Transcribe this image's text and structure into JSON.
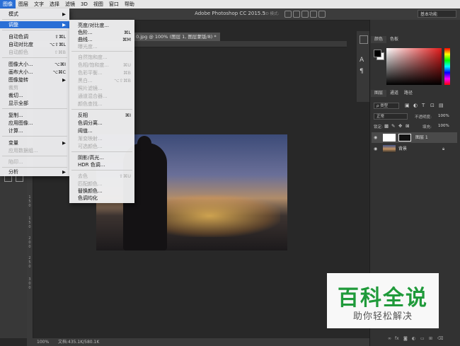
{
  "menubar": {
    "items": [
      "图像",
      "图层",
      "文字",
      "选择",
      "滤镜",
      "3D",
      "视图",
      "窗口",
      "帮助"
    ],
    "active_index": 0
  },
  "app_title": "Adobe Photoshop CC 2015.5",
  "options_bar": {
    "mode_3d": "3D 模式:",
    "workspace": "基本功能"
  },
  "document_tab": {
    "label": "0.jpg @ 100% (图层 1, 图层蒙版/8) *"
  },
  "ruler": {
    "left_labels": [
      "1",
      "5",
      "0",
      "1",
      "5",
      "0",
      "2",
      "0",
      "0",
      "2",
      "5",
      "0",
      "3",
      "0",
      "0"
    ]
  },
  "image_menu": {
    "items": [
      {
        "label": "模式",
        "shortcut": "",
        "arrow": true,
        "disabled": false
      },
      {
        "label": "调整",
        "shortcut": "",
        "arrow": true,
        "disabled": false,
        "highlighted": true
      },
      {
        "label": "自动色调",
        "shortcut": "⇧⌘L",
        "disabled": false
      },
      {
        "label": "自动对比度",
        "shortcut": "⌥⇧⌘L",
        "disabled": false
      },
      {
        "label": "自动颜色",
        "shortcut": "⇧⌘B",
        "disabled": true
      },
      {
        "label": "图像大小...",
        "shortcut": "⌥⌘I",
        "disabled": false
      },
      {
        "label": "画布大小...",
        "shortcut": "⌥⌘C",
        "disabled": false
      },
      {
        "label": "图像旋转",
        "shortcut": "",
        "arrow": true,
        "disabled": false
      },
      {
        "label": "裁剪",
        "shortcut": "",
        "disabled": true
      },
      {
        "label": "裁切...",
        "shortcut": "",
        "disabled": false
      },
      {
        "label": "显示全部",
        "shortcut": "",
        "disabled": false
      },
      {
        "label": "复制...",
        "shortcut": "",
        "disabled": false
      },
      {
        "label": "应用图像...",
        "shortcut": "",
        "disabled": false
      },
      {
        "label": "计算...",
        "shortcut": "",
        "disabled": false
      },
      {
        "label": "变量",
        "shortcut": "",
        "arrow": true,
        "disabled": false
      },
      {
        "label": "应用数据组...",
        "shortcut": "",
        "disabled": true
      },
      {
        "label": "陷印...",
        "shortcut": "",
        "disabled": true
      },
      {
        "label": "分析",
        "shortcut": "",
        "arrow": true,
        "disabled": false
      }
    ]
  },
  "adjust_submenu": {
    "items": [
      {
        "label": "亮度/对比度...",
        "shortcut": "",
        "disabled": false
      },
      {
        "label": "色阶...",
        "shortcut": "⌘L",
        "disabled": false
      },
      {
        "label": "曲线...",
        "shortcut": "⌘M",
        "disabled": false
      },
      {
        "label": "曝光度...",
        "shortcut": "",
        "disabled": true
      },
      {
        "label": "自然饱和度...",
        "shortcut": "",
        "disabled": true
      },
      {
        "label": "色相/饱和度...",
        "shortcut": "⌘U",
        "disabled": true
      },
      {
        "label": "色彩平衡...",
        "shortcut": "⌘B",
        "disabled": true
      },
      {
        "label": "黑白...",
        "shortcut": "⌥⇧⌘B",
        "disabled": true
      },
      {
        "label": "照片滤镜...",
        "shortcut": "",
        "disabled": true
      },
      {
        "label": "通道混合器...",
        "shortcut": "",
        "disabled": true
      },
      {
        "label": "颜色查找...",
        "shortcut": "",
        "disabled": true
      },
      {
        "label": "反相",
        "shortcut": "⌘I",
        "disabled": false
      },
      {
        "label": "色调分离...",
        "shortcut": "",
        "disabled": false
      },
      {
        "label": "阈值...",
        "shortcut": "",
        "disabled": false
      },
      {
        "label": "渐变映射...",
        "shortcut": "",
        "disabled": true
      },
      {
        "label": "可选颜色...",
        "shortcut": "",
        "disabled": true
      },
      {
        "label": "阴影/高光...",
        "shortcut": "",
        "disabled": false
      },
      {
        "label": "HDR 色调...",
        "shortcut": "",
        "disabled": false
      },
      {
        "label": "去色",
        "shortcut": "⇧⌘U",
        "disabled": true
      },
      {
        "label": "匹配颜色...",
        "shortcut": "",
        "disabled": true
      },
      {
        "label": "替换颜色...",
        "shortcut": "",
        "disabled": false
      },
      {
        "label": "色调均化",
        "shortcut": "",
        "disabled": false
      }
    ]
  },
  "color_panel": {
    "tabs": [
      "颜色",
      "色板"
    ]
  },
  "layers_panel": {
    "tabs": [
      "图层",
      "通道",
      "路径"
    ],
    "filter_kind": "ρ 类型",
    "blend_mode": "正常",
    "opacity_label": "不透明度:",
    "opacity_value": "100%",
    "lock_label": "锁定:",
    "fill_label": "填充:",
    "fill_value": "100%",
    "layers": [
      {
        "name": "图层 1",
        "visible": true,
        "selected": true
      },
      {
        "name": "背景",
        "visible": true,
        "selected": false
      }
    ]
  },
  "status_bar": {
    "zoom": "100%",
    "doc_info": "文档:435.1K/580.1K"
  },
  "watermark": {
    "title": "百科全说",
    "subtitle": "助你轻松解决"
  },
  "colors": {
    "accent": "#2a6fd6",
    "watermark_green": "#1f9a3a"
  }
}
